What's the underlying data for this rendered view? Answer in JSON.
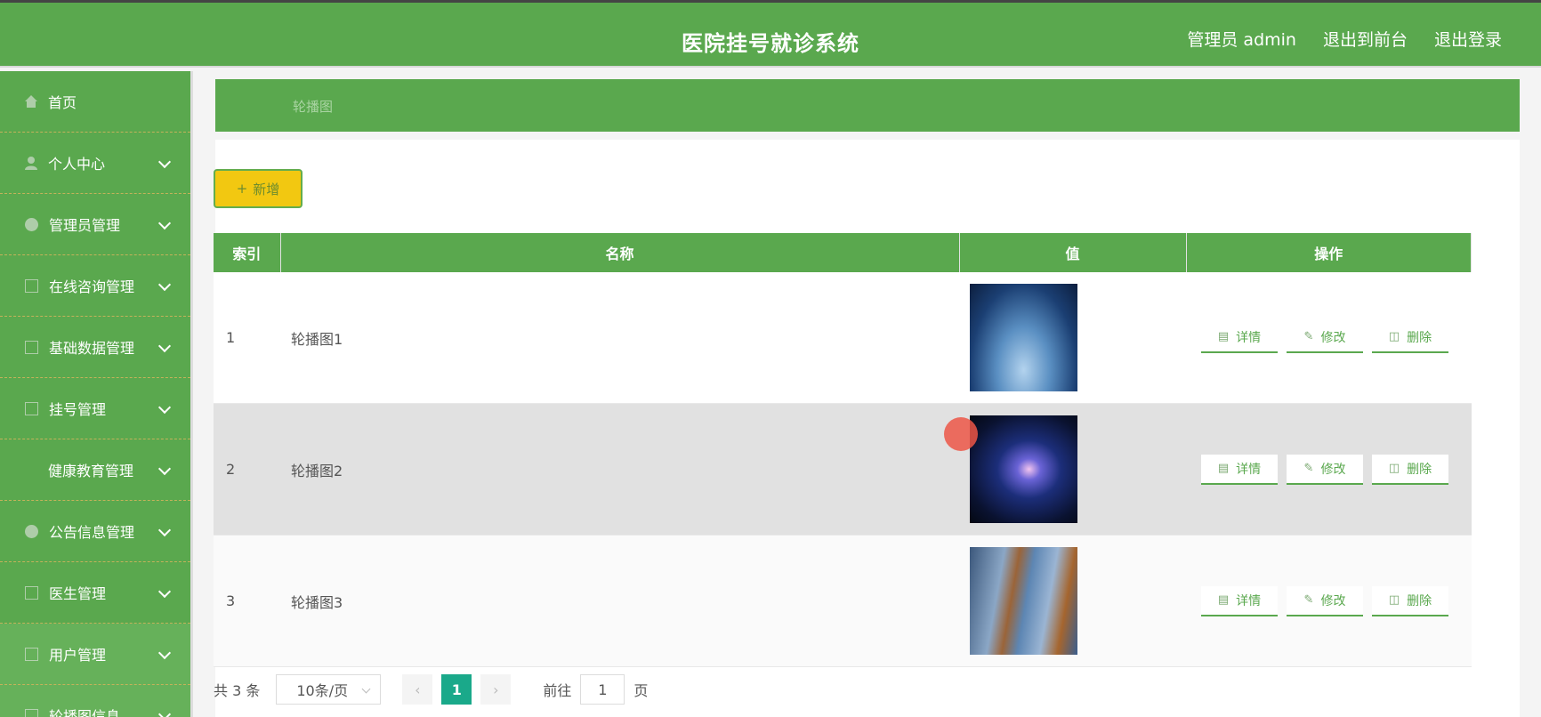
{
  "header": {
    "title": "医院挂号就诊系统",
    "links": [
      "管理员 admin",
      "退出到前台",
      "退出登录"
    ]
  },
  "sidebar": {
    "items": [
      {
        "label": "首页",
        "icon": "home-icon",
        "has_children": false
      },
      {
        "label": "个人中心",
        "icon": "user-icon",
        "has_children": true
      },
      {
        "label": "管理员管理",
        "icon": "circle-icon",
        "has_children": true
      },
      {
        "label": "在线咨询管理",
        "icon": "square-icon",
        "has_children": true
      },
      {
        "label": "基础数据管理",
        "icon": "square-icon",
        "has_children": true
      },
      {
        "label": "挂号管理",
        "icon": "square-icon",
        "has_children": true
      },
      {
        "label": "健康教育管理",
        "icon": "blank-icon",
        "has_children": true
      },
      {
        "label": "公告信息管理",
        "icon": "circle-icon",
        "has_children": true
      },
      {
        "label": "医生管理",
        "icon": "square-icon",
        "has_children": true
      },
      {
        "label": "用户管理",
        "icon": "square-icon",
        "has_children": true
      },
      {
        "label": "轮播图信息",
        "icon": "square-icon",
        "has_children": true
      }
    ]
  },
  "breadcrumb": "轮播图",
  "toolbar": {
    "add_label": "新增"
  },
  "table": {
    "headers": [
      "索引",
      "名称",
      "值",
      "操作"
    ],
    "rows": [
      {
        "index": "1",
        "name": "轮播图1",
        "image": "blue-ice-cave"
      },
      {
        "index": "2",
        "name": "轮播图2",
        "image": "glowing-light-cave"
      },
      {
        "index": "3",
        "name": "轮播图3",
        "image": "tree-trunk-sky"
      }
    ],
    "actions": [
      "详情",
      "修改",
      "删除"
    ]
  },
  "pagination": {
    "total_text": "共 3 条",
    "page_size": "10条/页",
    "current_page": "1",
    "goto_prefix": "前往",
    "goto_value": "1",
    "goto_suffix": "页"
  }
}
